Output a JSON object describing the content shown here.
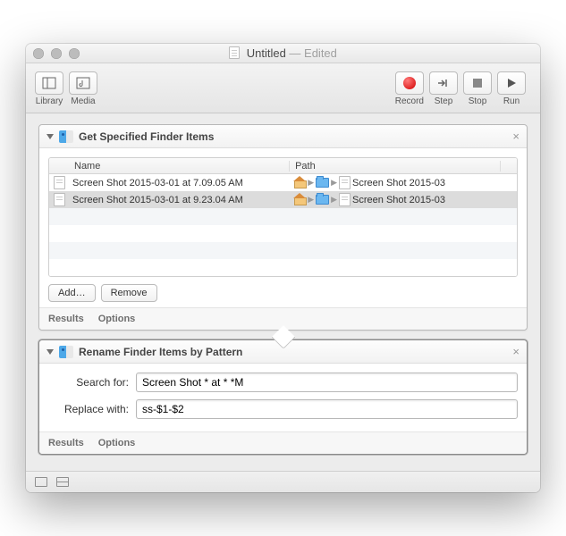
{
  "window": {
    "title": "Untitled",
    "edited_label": "— Edited"
  },
  "toolbar": {
    "library": "Library",
    "media": "Media",
    "record": "Record",
    "step": "Step",
    "stop": "Stop",
    "run": "Run"
  },
  "actions": {
    "get_items": {
      "title": "Get Specified Finder Items",
      "columns": {
        "name": "Name",
        "path": "Path"
      },
      "rows": [
        {
          "name": "Screen Shot 2015-03-01 at 7.09.05 AM",
          "path_text": "Screen Shot 2015-03"
        },
        {
          "name": "Screen Shot 2015-03-01 at 9.23.04 AM",
          "path_text": "Screen Shot 2015-03"
        }
      ],
      "add_label": "Add…",
      "remove_label": "Remove",
      "results_label": "Results",
      "options_label": "Options"
    },
    "rename": {
      "title": "Rename Finder Items by Pattern",
      "search_label": "Search for:",
      "search_value": "Screen Shot * at * *M",
      "replace_label": "Replace with:",
      "replace_value": "ss-$1-$2",
      "results_label": "Results",
      "options_label": "Options"
    }
  }
}
